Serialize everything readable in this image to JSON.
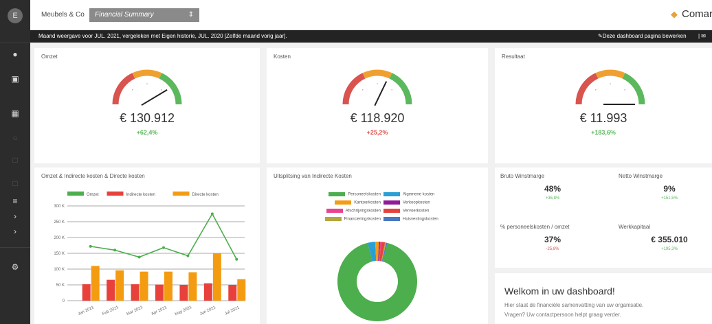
{
  "topbar": {
    "company": "Meubels & Co",
    "report_select": "Financial Summary",
    "brand": "Comar"
  },
  "infobar": {
    "text": "Maand weergave voor JUL. 2021, vergeleken met Eigen historie, JUL. 2020 [Zelfde maand vorig jaar].",
    "edit_label": "Deze dashboard pagina bewerken"
  },
  "kpis": [
    {
      "title": "Omzet",
      "value": "€ 130.912",
      "delta": "+62,4%",
      "needle": 0.8,
      "delta_color": "#5cb85c"
    },
    {
      "title": "Kosten",
      "value": "€ 118.920",
      "delta": "+25,2%",
      "needle": 0.62,
      "delta_color": "#d9534f"
    },
    {
      "title": "Resultaat",
      "value": "€ 11.993",
      "delta": "+183,6%",
      "needle": 1.0,
      "delta_color": "#5cb85c"
    }
  ],
  "gauge_colors": {
    "red": "#d9534f",
    "orange": "#f0a030",
    "green": "#5cb85c"
  },
  "chart_data": [
    {
      "type": "bar",
      "title": "Omzet & Indirecte kosten & Directe kosten",
      "categories": [
        "Jan 2021",
        "Feb 2021",
        "Mar 2021",
        "Apr 2021",
        "May 2021",
        "Jun 2021",
        "Jul 2021"
      ],
      "y_ticks": [
        "300 K",
        "250 K",
        "200 K",
        "150 K",
        "100 K",
        "50 K",
        "0"
      ],
      "ylim": [
        0,
        300000
      ],
      "series": [
        {
          "name": "Omzet",
          "kind": "line",
          "color": "#4cae4c",
          "values": [
            172000,
            160000,
            138000,
            168000,
            142000,
            275000,
            131000
          ]
        },
        {
          "name": "Indirecte kosten",
          "kind": "bar",
          "color": "#e8413c",
          "values": [
            52000,
            66000,
            52000,
            51000,
            50000,
            55000,
            50000
          ]
        },
        {
          "name": "Directe kosten",
          "kind": "bar",
          "color": "#f39c12",
          "values": [
            110000,
            96000,
            92000,
            92000,
            90000,
            150000,
            68000
          ]
        }
      ]
    },
    {
      "type": "pie",
      "title": "Uitsplitsing van Indirecte Kosten",
      "legend": [
        {
          "name": "Personeelskosten",
          "color": "#4cae4c"
        },
        {
          "name": "Algemene kosten",
          "color": "#2a9fd6"
        },
        {
          "name": "Kantoorkosten",
          "color": "#f39c12"
        },
        {
          "name": "Verkoopkosten",
          "color": "#8e1a99"
        },
        {
          "name": "Afschrijvingskosten",
          "color": "#e84393"
        },
        {
          "name": "Vervoerkosten",
          "color": "#e8413c"
        },
        {
          "name": "Financieringskosten",
          "color": "#b5a642"
        },
        {
          "name": "Huisvestingskosten",
          "color": "#4a78c2"
        }
      ],
      "values": [
        92.0,
        3.0,
        1.5,
        0.5,
        0.5,
        1.5,
        0.5,
        0.5
      ]
    }
  ],
  "metrics": [
    {
      "title": "Bruto Winstmarge",
      "value": "48%",
      "delta": "+36,8%",
      "color": "#5cb85c"
    },
    {
      "title": "Netto Winstmarge",
      "value": "9%",
      "delta": "+151,5%",
      "color": "#5cb85c"
    },
    {
      "title": "% personeelskosten / omzet",
      "value": "37%",
      "delta": "-25,8%",
      "color": "#d9534f"
    },
    {
      "title": "Werkkapitaal",
      "value": "€ 355.010",
      "delta": "+195,3%",
      "color": "#5cb85c"
    }
  ],
  "welcome": {
    "title": "Welkom in uw dashboard!",
    "line1": "Hier staat de financiële samenvatting van uw organisatie.",
    "line2": "Vragen? Uw contactpersoon helpt graag verder."
  },
  "icons": [
    "home-icon",
    "document-icon",
    "report-icon",
    "chart-icon",
    "grid-icon",
    "filter-icon",
    "chevron-right-icon",
    "gear-icon"
  ]
}
